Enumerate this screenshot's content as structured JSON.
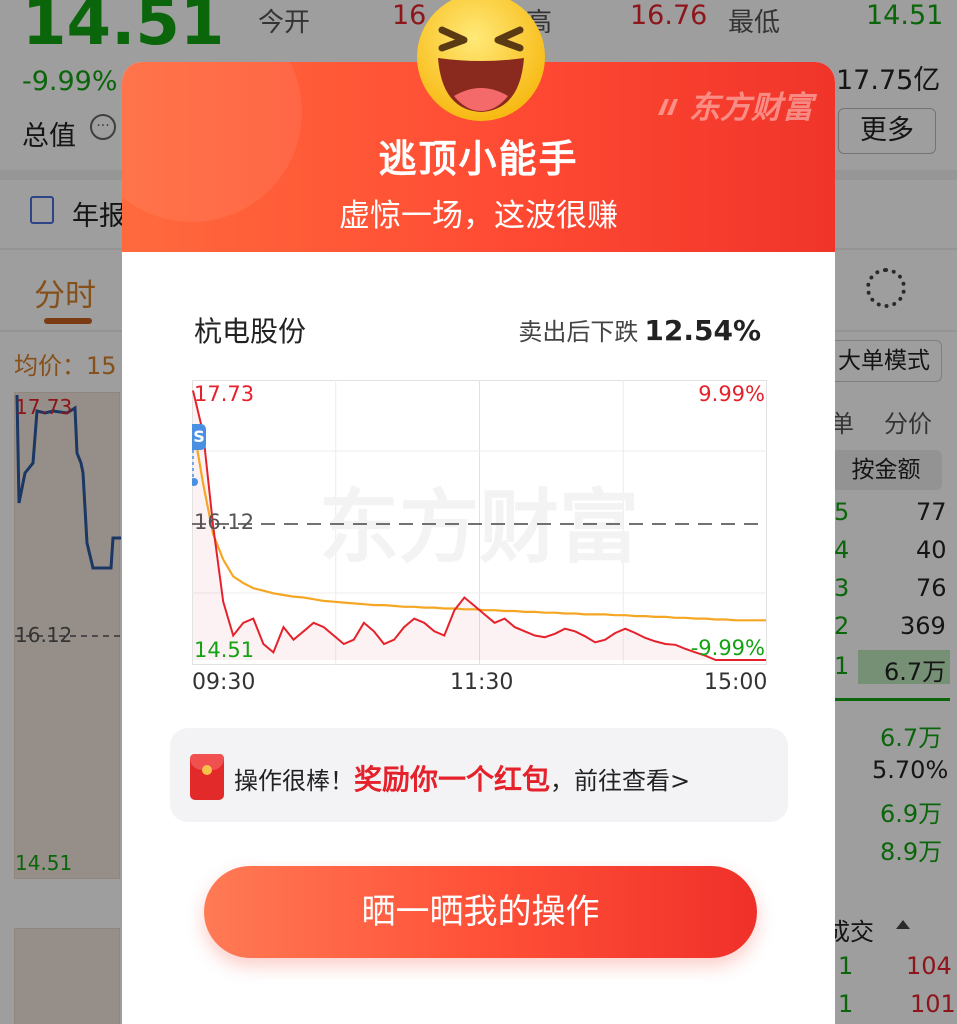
{
  "quote": {
    "price": "14.51",
    "change_pct": "-9.99%",
    "market_cap_label": "总值",
    "open_label": "今开",
    "open_value": "16",
    "high_label": "高",
    "high_value": "16.76",
    "low_label": "最低",
    "low_value": "14.51",
    "amount_value": "17.75亿",
    "more_button": "更多"
  },
  "bg": {
    "annual_report_tab": "年报",
    "tab_intraday": "分时",
    "avg_price_label": "均价：15",
    "chart_top": "17.73",
    "chart_ref": "16.12",
    "chart_bottom": "14.51",
    "big_order_mode": "大单模式",
    "col_unit": "单",
    "col_price": "分价",
    "by_amount": "按金额",
    "levels": [
      {
        "level": "5",
        "value": "77"
      },
      {
        "level": "4",
        "value": "40"
      },
      {
        "level": "3",
        "value": "76"
      },
      {
        "level": "2",
        "value": "369"
      },
      {
        "level": "1",
        "value": "6.7万"
      }
    ],
    "stats": [
      "6.7万",
      "5.70%",
      "6.9万",
      "8.9万"
    ],
    "deal_label": "成交",
    "deals": [
      {
        "level": "1",
        "value": "104"
      },
      {
        "level": "1",
        "value": "101"
      }
    ]
  },
  "dialog": {
    "brand": "东方财富",
    "title": "逃顶小能手",
    "subtitle": "虚惊一场，这波很赚",
    "stock_name": "杭电股份",
    "drop_label": "卖出后下跌",
    "drop_value": "12.54%",
    "chart_top_price": "17.73",
    "chart_top_pct": "9.99%",
    "chart_ref_price": "16.12",
    "chart_bottom_price": "14.51",
    "chart_bottom_pct": "-9.99%",
    "sell_marker": "S",
    "watermark": "东方财富",
    "time_ticks": [
      "09:30",
      "11:30",
      "15:00"
    ],
    "reward_prefix": "操作很棒！",
    "reward_highlight": "奖励你一个红包",
    "reward_suffix": "，前往查看>",
    "share_button": "晒一晒我的操作"
  },
  "colors": {
    "rise": "#e5222b",
    "fall": "#13a313",
    "accent": "#ff5138",
    "avg_line": "#f5a623",
    "price_line": "#e5222b"
  },
  "chart_data": {
    "type": "line",
    "title": "",
    "xlabel": "",
    "ylabel": "",
    "x_ticks": [
      "09:30",
      "11:30",
      "15:00"
    ],
    "ylim": [
      14.51,
      17.73
    ],
    "reference": 16.12,
    "series": [
      {
        "values": [
          17.7,
          17.2,
          16.1,
          15.2,
          14.8,
          14.95,
          15.0,
          14.7,
          14.6,
          14.9,
          14.75,
          14.85,
          14.95,
          14.9,
          14.8,
          14.7,
          14.75,
          14.95,
          14.85,
          14.7,
          14.75,
          14.9,
          15.0,
          14.95,
          14.85,
          14.8,
          15.1,
          15.25,
          15.15,
          15.05,
          14.95,
          15.0,
          14.9,
          14.85,
          14.8,
          14.78,
          14.82,
          14.88,
          14.85,
          14.79,
          14.72,
          14.75,
          14.83,
          14.88,
          14.83,
          14.77,
          14.73,
          14.7,
          14.69,
          14.64,
          14.6,
          14.56,
          14.51,
          14.51,
          14.51,
          14.51,
          14.51,
          14.51
        ]
      },
      {
        "values": [
          17.3,
          16.6,
          16.0,
          15.7,
          15.5,
          15.42,
          15.36,
          15.33,
          15.3,
          15.28,
          15.26,
          15.25,
          15.23,
          15.21,
          15.2,
          15.19,
          15.18,
          15.17,
          15.16,
          15.16,
          15.15,
          15.14,
          15.14,
          15.13,
          15.13,
          15.12,
          15.12,
          15.11,
          15.11,
          15.1,
          15.1,
          15.09,
          15.09,
          15.08,
          15.08,
          15.07,
          15.07,
          15.06,
          15.06,
          15.05,
          15.05,
          15.05,
          15.04,
          15.04,
          15.03,
          15.03,
          15.02,
          15.02,
          15.01,
          15.01,
          15.0,
          15.0,
          14.99,
          14.99,
          14.98,
          14.98,
          14.98,
          14.98
        ]
      }
    ]
  }
}
